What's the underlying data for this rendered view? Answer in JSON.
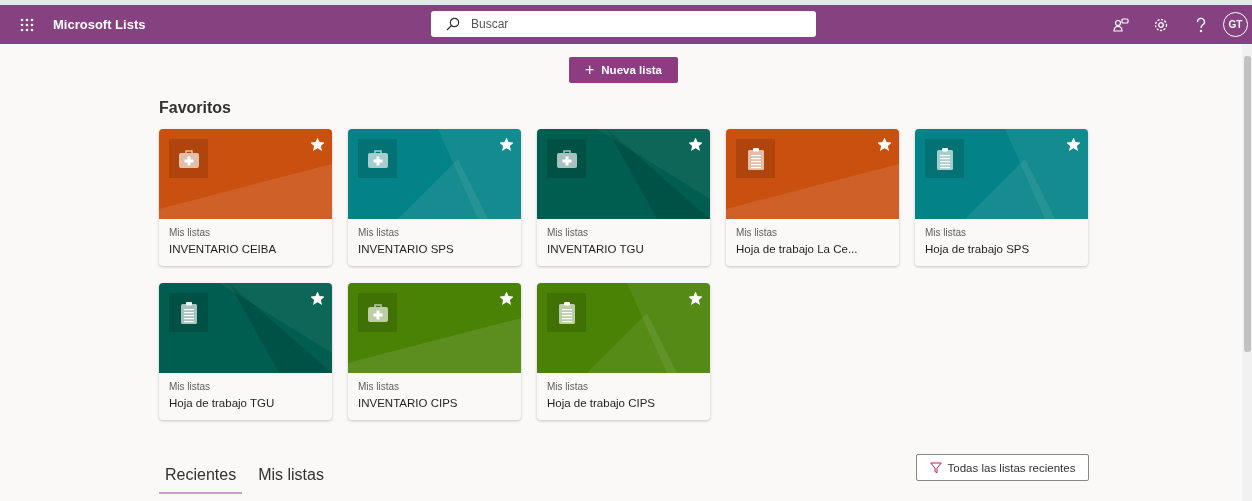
{
  "app_bar": {
    "title": "Microsoft Lists",
    "search": {
      "placeholder": "Buscar"
    },
    "avatar": "GT"
  },
  "new_list_button": {
    "icon": "+",
    "label": "Nueva lista"
  },
  "favorites": {
    "heading": "Favoritos",
    "cards": [
      {
        "location": "Mis listas",
        "title": "INVENTARIO CEIBA",
        "color": "#ca5010",
        "kind": "medkit",
        "favorite": true
      },
      {
        "location": "Mis listas",
        "title": "INVENTARIO SPS",
        "color": "#038387",
        "kind": "medkit",
        "favorite": true
      },
      {
        "location": "Mis listas",
        "title": "INVENTARIO TGU",
        "color": "#005e50",
        "kind": "medkit",
        "favorite": true
      },
      {
        "location": "Mis listas",
        "title": "Hoja de trabajo La Ce...",
        "color": "#ca5010",
        "kind": "clipboard",
        "favorite": true
      },
      {
        "location": "Mis listas",
        "title": "Hoja de trabajo SPS",
        "color": "#038387",
        "kind": "clipboard",
        "favorite": true
      },
      {
        "location": "Mis listas",
        "title": "Hoja de trabajo TGU",
        "color": "#005e50",
        "kind": "clipboard",
        "favorite": true
      },
      {
        "location": "Mis listas",
        "title": "INVENTARIO CIPS",
        "color": "#498205",
        "kind": "medkit",
        "favorite": true
      },
      {
        "location": "Mis listas",
        "title": "Hoja de trabajo CIPS",
        "color": "#498205",
        "kind": "clipboard",
        "favorite": true
      }
    ]
  },
  "tabs": [
    {
      "label": "Recientes",
      "selected": true
    },
    {
      "label": "Mis listas",
      "selected": false
    }
  ],
  "filter_button": {
    "label": "Todas las listas recientes"
  }
}
